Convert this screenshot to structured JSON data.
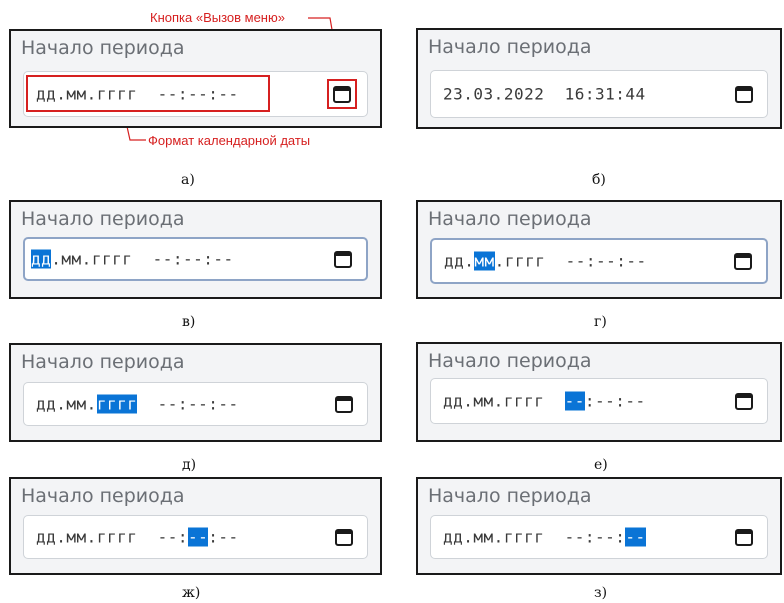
{
  "annotations": {
    "menu_button": "Кнопка «Вызов меню»",
    "date_format": "Формат календарной даты"
  },
  "icons": {
    "calendar": "calendar-icon"
  },
  "colors": {
    "selection": "#0a74d6",
    "annotation": "#d62020",
    "panel_bg": "#f3f4f6",
    "label": "#6b6f75"
  },
  "panels": [
    {
      "caption": "а)",
      "label": "Начало периода",
      "segments": [
        "дд",
        ".",
        "мм",
        ".",
        "гггг",
        "  ",
        "--",
        ":",
        "--",
        ":",
        "--"
      ],
      "selected": -1
    },
    {
      "caption": "б)",
      "label": "Начало периода",
      "segments": [
        "23",
        ".",
        "03",
        ".",
        "2022",
        "  ",
        "16",
        ":",
        "31",
        ":",
        "44"
      ],
      "selected": -1
    },
    {
      "caption": "в)",
      "label": "Начало периода",
      "segments": [
        "дд",
        ".",
        "мм",
        ".",
        "гггг",
        "  ",
        "--",
        ":",
        "--",
        ":",
        "--"
      ],
      "selected": 0
    },
    {
      "caption": "г)",
      "label": "Начало периода",
      "segments": [
        "дд",
        ".",
        "мм",
        ".",
        "гггг",
        "  ",
        "--",
        ":",
        "--",
        ":",
        "--"
      ],
      "selected": 2
    },
    {
      "caption": "д)",
      "label": "Начало периода",
      "segments": [
        "дд",
        ".",
        "мм",
        ".",
        "гггг",
        "  ",
        "--",
        ":",
        "--",
        ":",
        "--"
      ],
      "selected": 4
    },
    {
      "caption": "е)",
      "label": "Начало периода",
      "segments": [
        "дд",
        ".",
        "мм",
        ".",
        "гггг",
        "  ",
        "--",
        ":",
        "--",
        ":",
        "--"
      ],
      "selected": 6
    },
    {
      "caption": "ж)",
      "label": "Начало периода",
      "segments": [
        "дд",
        ".",
        "мм",
        ".",
        "гггг",
        "  ",
        "--",
        ":",
        "--",
        ":",
        "--"
      ],
      "selected": 8
    },
    {
      "caption": "з)",
      "label": "Начало периода",
      "segments": [
        "дд",
        ".",
        "мм",
        ".",
        "гггг",
        "  ",
        "--",
        ":",
        "--",
        ":",
        "--"
      ],
      "selected": 10
    }
  ]
}
